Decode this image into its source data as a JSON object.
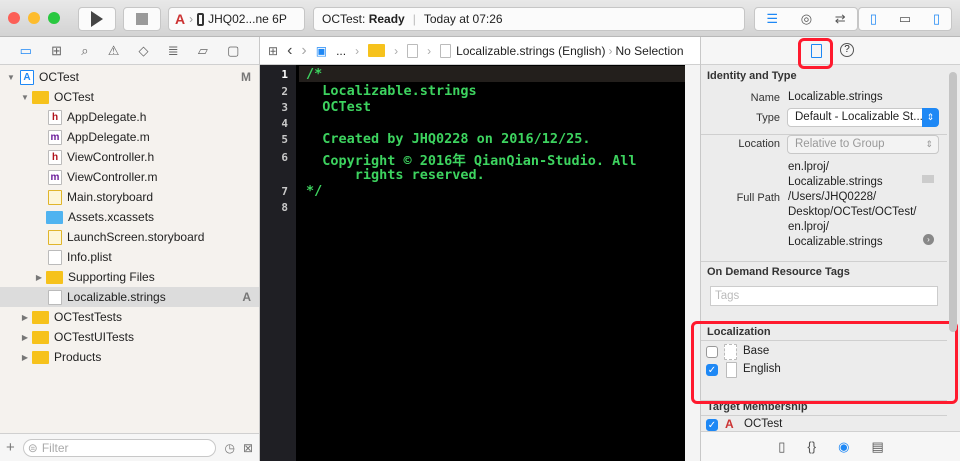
{
  "toolbar": {
    "scheme": "JHQ02...ne 6P",
    "status_project": "OCTest:",
    "status_state": "Ready",
    "status_time": "Today at 07:26"
  },
  "navigator": {
    "items": [
      {
        "label": "OCTest",
        "badge": "M"
      },
      {
        "label": "OCTest"
      },
      {
        "label": "AppDelegate.h"
      },
      {
        "label": "AppDelegate.m"
      },
      {
        "label": "ViewController.h"
      },
      {
        "label": "ViewController.m"
      },
      {
        "label": "Main.storyboard"
      },
      {
        "label": "Assets.xcassets"
      },
      {
        "label": "LaunchScreen.storyboard"
      },
      {
        "label": "Info.plist"
      },
      {
        "label": "Supporting Files"
      },
      {
        "label": "Localizable.strings",
        "badge": "A"
      },
      {
        "label": "OCTestTests"
      },
      {
        "label": "OCTestUITests"
      },
      {
        "label": "Products"
      }
    ],
    "filter_placeholder": "Filter"
  },
  "jumpbar": {
    "ellipsis": "...",
    "file": "Localizable.strings (English)",
    "selection": "No Selection"
  },
  "editor": {
    "line_numbers": [
      "1",
      "2",
      "3",
      "4",
      "5",
      "6",
      "7",
      "8"
    ],
    "lines": [
      "/*",
      "  Localizable.strings",
      "  OCTest",
      "",
      "  Created by JHQ0228 on 2016/12/25.",
      "  Copyright © 2016年 QianQian-Studio. All",
      "      rights reserved.",
      "*/"
    ]
  },
  "inspector": {
    "identity_title": "Identity and Type",
    "name_label": "Name",
    "name_value": "Localizable.strings",
    "type_label": "Type",
    "type_value": "Default - Localizable St...",
    "location_label": "Location",
    "location_value": "Relative to Group",
    "location_path": [
      "en.lproj/",
      "Localizable.strings"
    ],
    "fullpath_label": "Full Path",
    "fullpath_value": [
      "/Users/JHQ0228/",
      "Desktop/OCTest/OCTest/",
      "en.lproj/",
      "Localizable.strings"
    ],
    "odr_title": "On Demand Resource Tags",
    "tags_placeholder": "Tags",
    "localization_title": "Localization",
    "localizations": [
      {
        "label": "Base",
        "checked": false
      },
      {
        "label": "English",
        "checked": true
      }
    ],
    "target_title": "Target Membership",
    "targets": [
      {
        "label": "OCTest",
        "checked": true
      }
    ]
  },
  "colors": {
    "accent": "#1e88f5",
    "highlight": "#ff1a2e",
    "code": "#3dd35f"
  }
}
